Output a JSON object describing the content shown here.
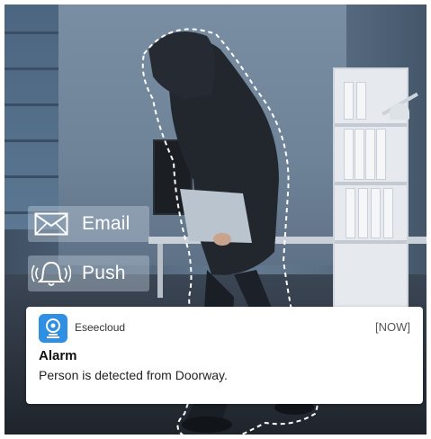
{
  "badges": {
    "email": {
      "label": "Email",
      "icon": "envelope-icon"
    },
    "push": {
      "label": "Push",
      "icon": "bell-icon"
    }
  },
  "notification": {
    "app_name": "Eseecloud",
    "app_icon": "camera-icon",
    "time": "[NOW]",
    "title": "Alarm",
    "message": "Person is detected from Doorway."
  },
  "colors": {
    "app_icon_bg": "#2f8fe3",
    "outline": "#ffffff",
    "badge_bg": "#bfcddc"
  }
}
